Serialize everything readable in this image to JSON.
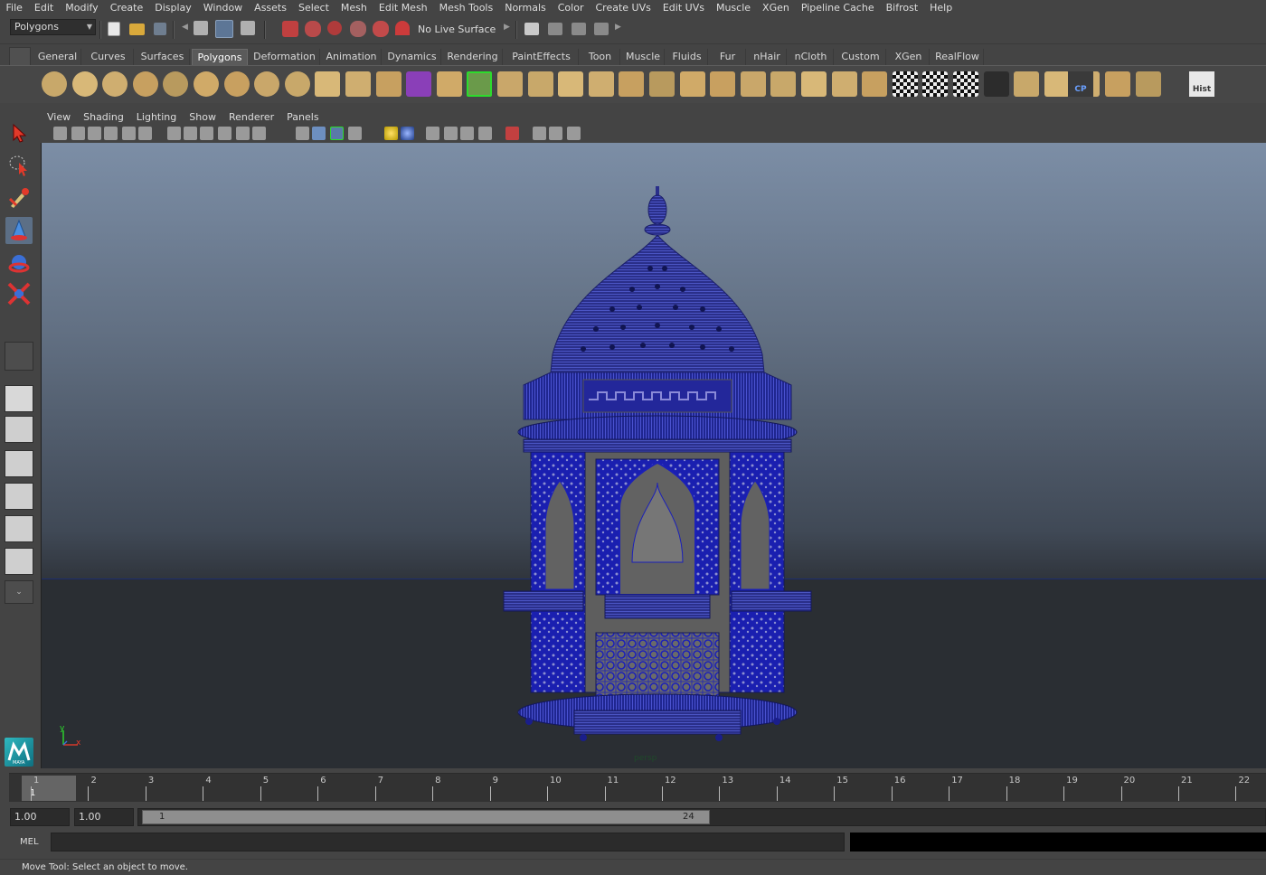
{
  "menubar": [
    "File",
    "Edit",
    "Modify",
    "Create",
    "Display",
    "Window",
    "Assets",
    "Select",
    "Mesh",
    "Edit Mesh",
    "Mesh Tools",
    "Normals",
    "Color",
    "Create UVs",
    "Edit UVs",
    "Muscle",
    "XGen",
    "Pipeline Cache",
    "Bifrost",
    "Help"
  ],
  "status_line": {
    "menuset": "Polygons",
    "live_surface": "No Live Surface"
  },
  "shelf_tabs": [
    "General",
    "Curves",
    "Surfaces",
    "Polygons",
    "Deformation",
    "Animation",
    "Dynamics",
    "Rendering",
    "PaintEffects",
    "Toon",
    "Muscle",
    "Fluids",
    "Fur",
    "nHair",
    "nCloth",
    "Custom",
    "XGen",
    "RealFlow"
  ],
  "active_shelf_tab": "Polygons",
  "shelf_icons": [
    "sphere-icon",
    "cube-icon",
    "cylinder-icon",
    "cone-icon",
    "plane-icon",
    "torus-icon",
    "pyramid-icon",
    "pipe-icon",
    "soccer-ball-icon",
    "combine-icon",
    "sphere-mesh-icon",
    "sphere-mesh2-icon",
    "purple-cube-icon",
    "extrude-icon",
    "bridge-icon",
    "append-icon",
    "split-icon",
    "insert-loop-icon",
    "cut-icon",
    "offset-icon",
    "merge-icon",
    "collapse-icon",
    "fill-hole-icon",
    "bevel-icon",
    "smooth-icon",
    "reduce-icon",
    "triangulate-icon",
    "quadrangulate-icon",
    "uv-checker-icon",
    "uv-checker2-icon",
    "uv-checker3-icon",
    "uv-sphere-icon",
    "uv-square-icon",
    "uv-prism-icon",
    "uv-layout-icon",
    "uv-grid-icon",
    "uv-cut-icon"
  ],
  "shelf_text_icons": {
    "cp": "CP",
    "hist": "Hist"
  },
  "panel_menu": [
    "View",
    "Shading",
    "Lighting",
    "Show",
    "Renderer",
    "Panels"
  ],
  "viewport": {
    "camera_label": "persp",
    "axis_y": "y",
    "axis_x": "x"
  },
  "time_slider": {
    "ticks": [
      "1",
      "2",
      "3",
      "4",
      "5",
      "6",
      "7",
      "8",
      "9",
      "10",
      "11",
      "12",
      "13",
      "14",
      "15",
      "16",
      "17",
      "18",
      "19",
      "20",
      "21",
      "22"
    ],
    "current": "1"
  },
  "range_slider": {
    "start_time": "1.00",
    "playback_start": "1.00",
    "range_start": "1",
    "range_end": "24"
  },
  "command_line": {
    "label": "MEL"
  },
  "help_line": "Move Tool: Select an object to move.",
  "maya_logo": "MAYA"
}
